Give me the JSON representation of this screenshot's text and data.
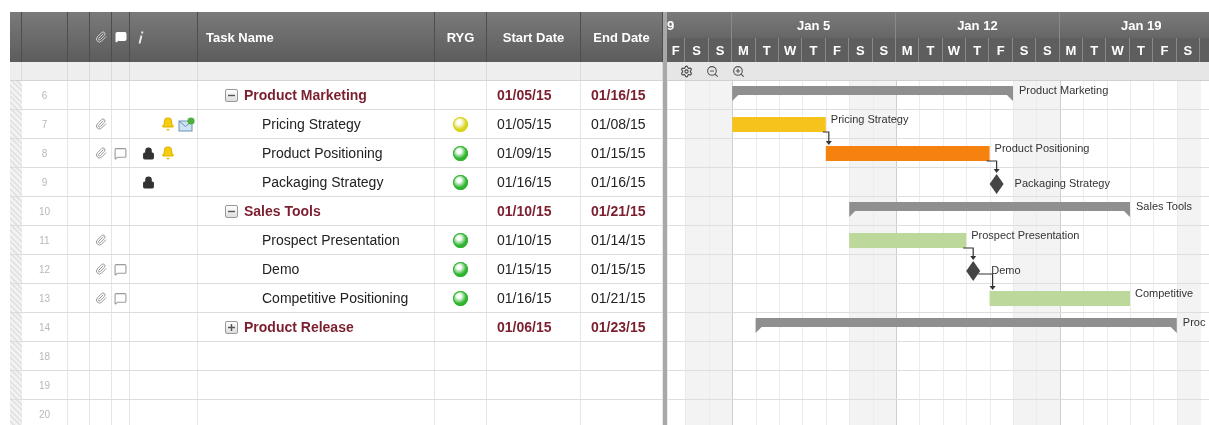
{
  "columns": {
    "task_name": "Task Name",
    "status": "RYG",
    "start": "Start Date",
    "end": "End Date"
  },
  "gantt": {
    "weeks": [
      "9",
      "Jan 5",
      "Jan 12",
      "Jan 19"
    ],
    "days": [
      "F",
      "S",
      "S",
      "M",
      "T",
      "W",
      "T",
      "F",
      "S",
      "S",
      "M",
      "T",
      "W",
      "T",
      "F",
      "S",
      "S",
      "M",
      "T",
      "W",
      "T",
      "F",
      "S"
    ]
  },
  "rows": [
    {
      "num": "6",
      "kind": "parent",
      "name": "Product Marketing",
      "expanded": true,
      "start": "01/05/15",
      "end": "01/16/15",
      "bar": {
        "kind": "summary",
        "label": "Product Marketing"
      }
    },
    {
      "num": "7",
      "kind": "task",
      "name": "Pricing Strategy",
      "color": "#d8d41c",
      "start": "01/05/15",
      "end": "01/08/15",
      "attachment": true,
      "comment": false,
      "locked": false,
      "reminder": true,
      "update_request": true,
      "bar": {
        "kind": "task",
        "label": "Pricing Strategy",
        "color": "#f6c21c",
        "depends_on_previous": false
      }
    },
    {
      "num": "8",
      "kind": "task",
      "name": "Product Positioning",
      "color": "#2fb52f",
      "start": "01/09/15",
      "end": "01/15/15",
      "attachment": true,
      "comment": true,
      "locked": true,
      "reminder": true,
      "update_request": false,
      "bar": {
        "kind": "task",
        "label": "Product Positioning",
        "color": "#f5820f",
        "depends_on_previous": true
      }
    },
    {
      "num": "9",
      "kind": "task",
      "name": "Packaging Strategy",
      "color": "#2fb52f",
      "start": "01/16/15",
      "end": "01/16/15",
      "attachment": false,
      "comment": false,
      "locked": true,
      "reminder": false,
      "update_request": false,
      "bar": {
        "kind": "milestone",
        "label": "Packaging Strategy",
        "depends_on_previous": true
      }
    },
    {
      "num": "10",
      "kind": "parent",
      "name": "Sales Tools",
      "expanded": true,
      "start": "01/10/15",
      "end": "01/21/15",
      "bar": {
        "kind": "summary",
        "label": "Sales Tools"
      }
    },
    {
      "num": "11",
      "kind": "task",
      "name": "Prospect Presentation",
      "color": "#2fb52f",
      "start": "01/10/15",
      "end": "01/14/15",
      "attachment": true,
      "comment": false,
      "locked": false,
      "reminder": false,
      "update_request": false,
      "bar": {
        "kind": "task",
        "label": "Prospect Presentation",
        "color": "#bcd89a",
        "depends_on_previous": false
      }
    },
    {
      "num": "12",
      "kind": "task",
      "name": "Demo",
      "color": "#2fb52f",
      "start": "01/15/15",
      "end": "01/15/15",
      "attachment": true,
      "comment": true,
      "locked": false,
      "reminder": false,
      "update_request": false,
      "bar": {
        "kind": "milestone",
        "label": "Demo",
        "depends_on_previous": true
      }
    },
    {
      "num": "13",
      "kind": "task",
      "name": "Competitive Positioning",
      "color": "#2fb52f",
      "start": "01/16/15",
      "end": "01/21/15",
      "attachment": true,
      "comment": true,
      "locked": false,
      "reminder": false,
      "update_request": false,
      "bar": {
        "kind": "task",
        "label": "Competitive",
        "color": "#bcd89a",
        "depends_on_previous": true
      }
    },
    {
      "num": "14",
      "kind": "parent",
      "name": "Product Release",
      "expanded": false,
      "start": "01/06/15",
      "end": "01/23/15",
      "bar": {
        "kind": "summary",
        "label": "Proc"
      }
    },
    {
      "num": "18",
      "kind": "empty"
    },
    {
      "num": "19",
      "kind": "empty"
    },
    {
      "num": "20",
      "kind": "empty"
    }
  ]
}
